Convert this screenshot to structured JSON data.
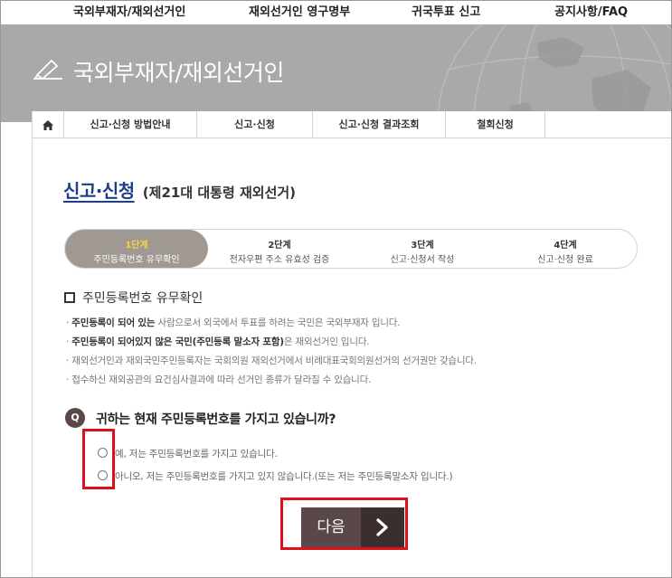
{
  "topnav": {
    "items": [
      "국외부재자/재외선거인",
      "재외선거인 영구명부",
      "귀국투표 신고",
      "공지사항/FAQ"
    ]
  },
  "banner": {
    "title": "국외부재자/재외선거인"
  },
  "subnav": {
    "tabs": [
      "신고·신청 방법안내",
      "신고·신청",
      "신고·신청 결과조회",
      "철회신청"
    ]
  },
  "heading": {
    "main": "신고·신청",
    "sub": "(제21대 대통령 재외선거)"
  },
  "steps": [
    {
      "num": "1단계",
      "desc": "주민등록번호 유무확인",
      "active": true
    },
    {
      "num": "2단계",
      "desc": "전자우편 주소 유효성 검증",
      "active": false
    },
    {
      "num": "3단계",
      "desc": "신고·신청서 작성",
      "active": false
    },
    {
      "num": "4단계",
      "desc": "신고·신청 완료",
      "active": false
    }
  ],
  "section": {
    "title": "주민등록번호 유무확인",
    "notes": [
      {
        "bold": "주민등록이 되어 있는",
        "rest": " 사람으로서 외국에서 투표를 하려는 국민은 국외부재자 입니다."
      },
      {
        "bold": "주민등록이 되어있지 않은 국민(주민등록 말소자 포함)",
        "rest": "은 재외선거인 입니다."
      },
      {
        "bold": "",
        "rest": "재외선거인과 재외국민주민등록자는 국회의원 재외선거에서 비례대표국회의원선거의 선거권만 갖습니다."
      },
      {
        "bold": "",
        "rest": "접수하신 재외공관의 요건심사결과에 따라 선거인 종류가 달라질 수 있습니다."
      }
    ]
  },
  "question": {
    "badge": "Q",
    "text": "귀하는 현재 주민등록번호를 가지고 있습니까?",
    "options": [
      "예, 저는 주민등록번호를 가지고 있습니다.",
      "아니오, 저는 주민등록번호를 가지고 있지 않습니다.(또는 저는 주민등록말소자 입니다.)"
    ]
  },
  "next_button": {
    "label": "다음"
  },
  "colors": {
    "banner": "#a9a9a9",
    "heading": "#1f3d8a",
    "active_step": "#a09892",
    "active_step_num": "#f4d23a",
    "button": "#5a4848",
    "highlight": "#e0101a"
  }
}
